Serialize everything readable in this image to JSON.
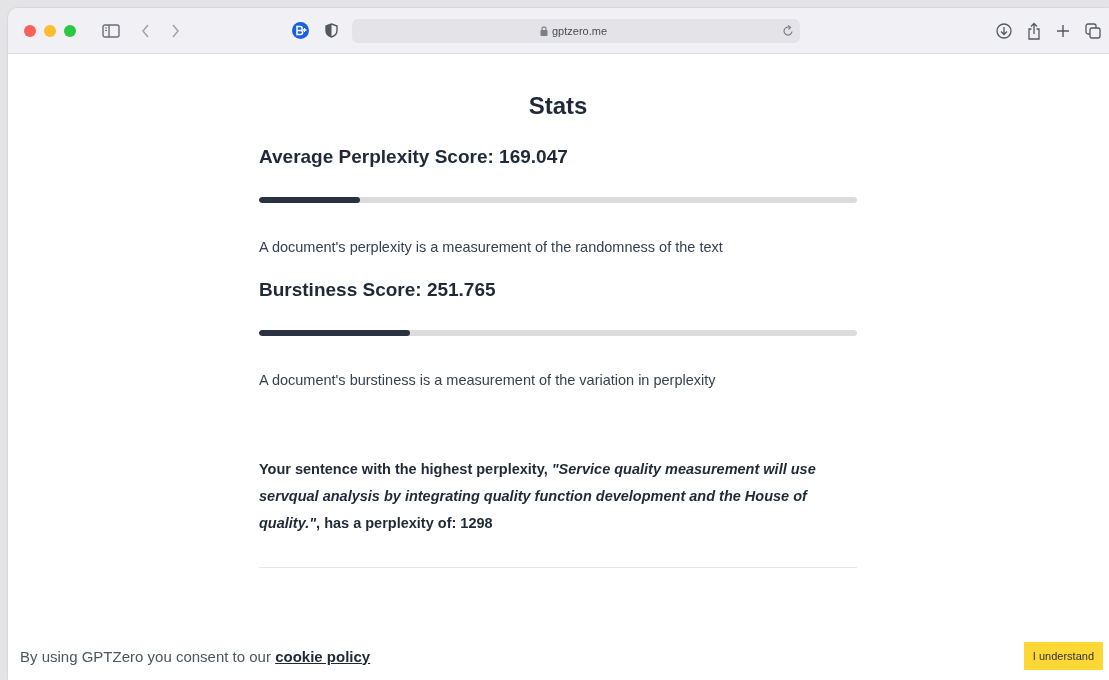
{
  "browser": {
    "url": "gptzero.me"
  },
  "page": {
    "title": "Stats",
    "metrics": [
      {
        "heading": "Average Perplexity Score: 169.047",
        "level": 0.169,
        "description": "A document's perplexity is a measurement of the randomness of the text"
      },
      {
        "heading": "Burstiness Score: 251.765",
        "level": 0.252,
        "description": "A document's burstiness is a measurement of the variation in perplexity"
      }
    ],
    "highest_sentence": "Your sentence with the highest perplexity, *\"Service quality measurement will use servqual analysis by integrating quality function development and the House of quality.\"*, has a perplexity of: 1298"
  },
  "cookie_banner": {
    "text": "By using GPTZero you consent to our",
    "link": "cookie policy",
    "button": "I understand"
  }
}
